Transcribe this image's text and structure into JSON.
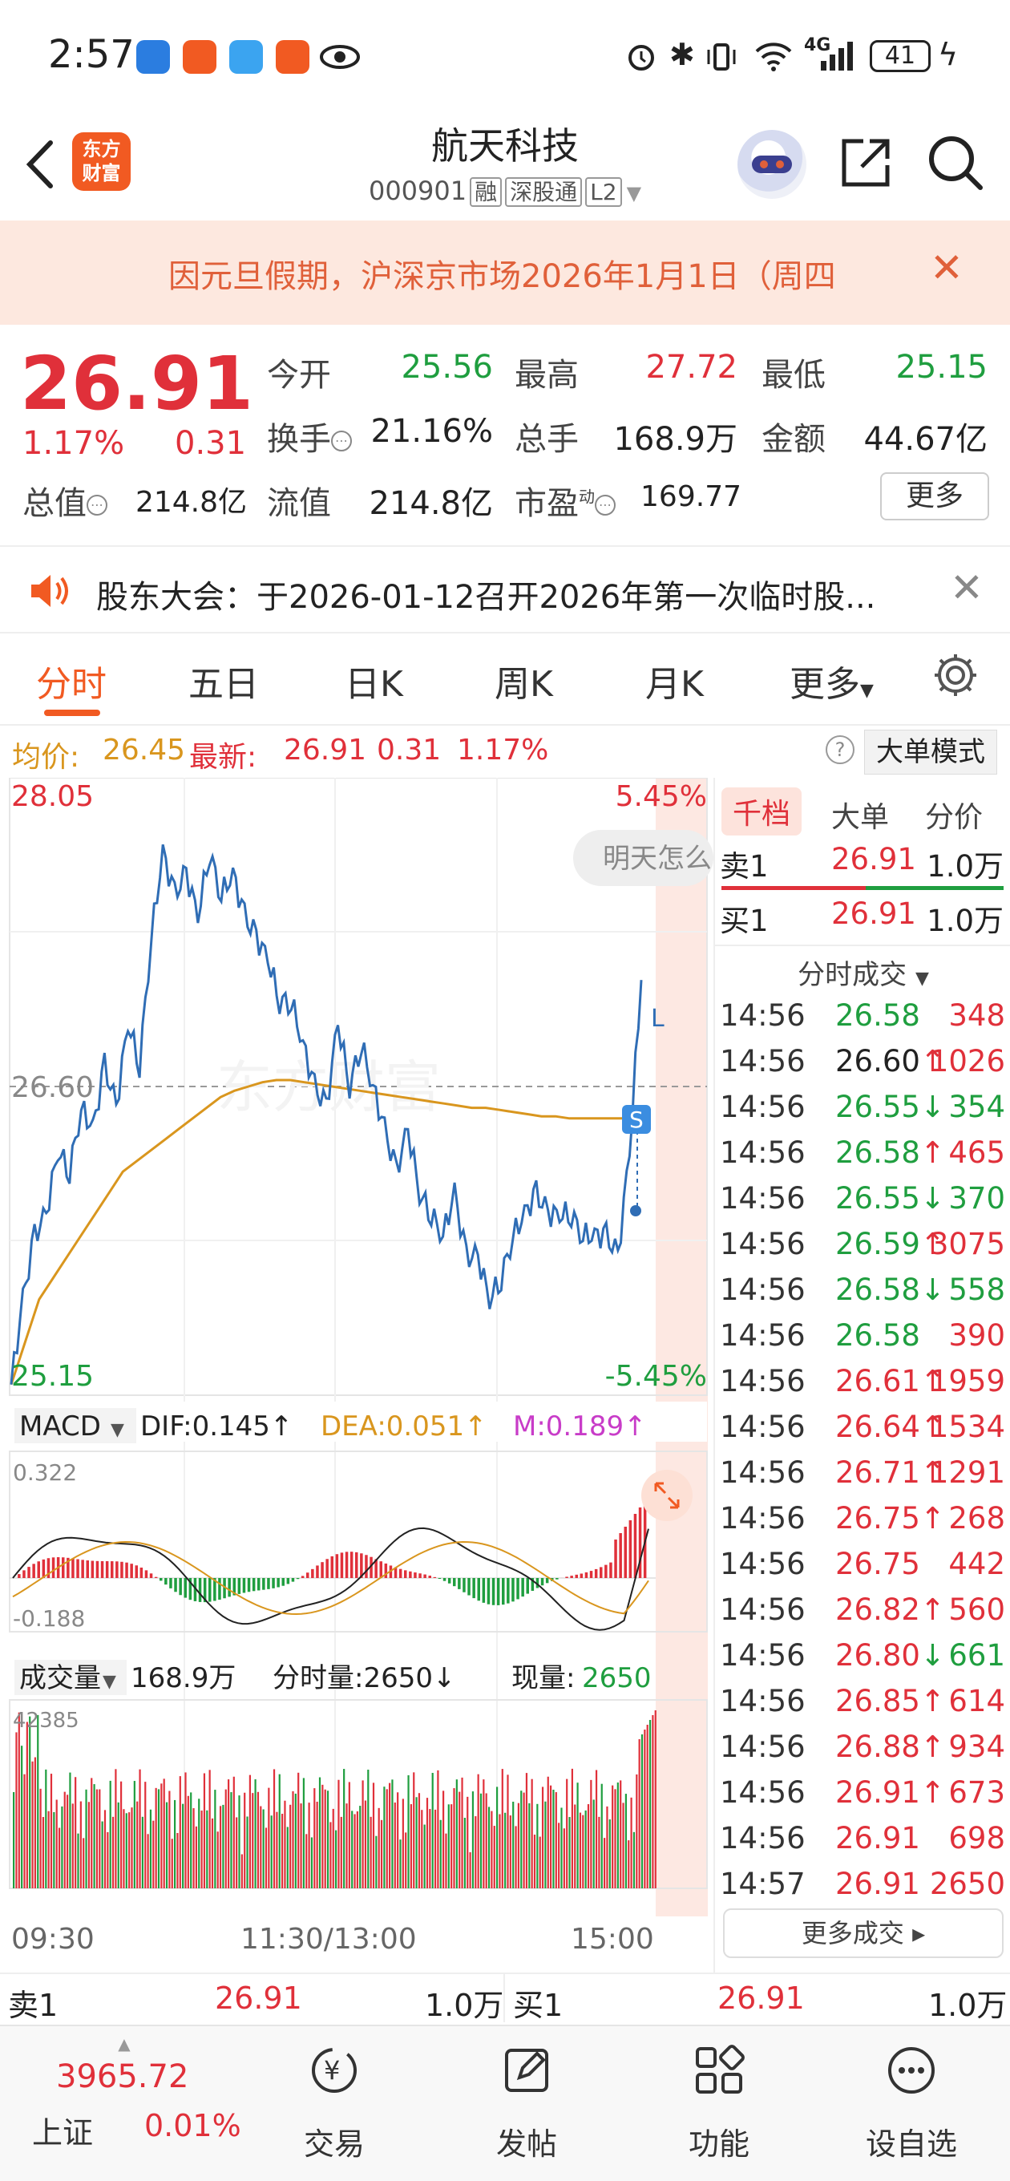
{
  "status_bar": {
    "time": "2:57",
    "network": "4G",
    "battery": "41"
  },
  "header": {
    "logo_text_1": "东方",
    "logo_text_2": "财富",
    "title": "航天科技",
    "code": "000901",
    "tags": [
      "融",
      "深股通",
      "L2"
    ]
  },
  "notice": {
    "text": "因元旦假期，沪深京市场2026年1月1日（周四"
  },
  "quote": {
    "price": "26.91",
    "change_pct": "1.17%",
    "change": "0.31",
    "open_label": "今开",
    "open": "25.56",
    "high_label": "最高",
    "high": "27.72",
    "low_label": "最低",
    "low": "25.15",
    "turnover_label": "换手",
    "turnover": "21.16%",
    "volume_label": "总手",
    "volume": "168.9万",
    "amount_label": "金额",
    "amount": "44.67亿",
    "mktcap_label": "总值",
    "mktcap": "214.8亿",
    "float_label": "流值",
    "float": "214.8亿",
    "pe_label": "市盈",
    "pe_sup": "动",
    "pe": "169.77",
    "more": "更多"
  },
  "announcement": {
    "text": "股东大会：于2026-01-12召开2026年第一次临时股..."
  },
  "tabs": [
    "分时",
    "五日",
    "日K",
    "周K",
    "月K",
    "更多"
  ],
  "summary": {
    "avg_label": "均价:",
    "avg": "26.45",
    "latest_label": "最新:",
    "latest": "26.91",
    "chg": "0.31",
    "pct": "1.17%",
    "big_order_mode": "大单模式"
  },
  "chart_labels": {
    "y_top": "28.05",
    "y_top_pct": "5.45%",
    "y_mid": "26.60",
    "y_bottom": "25.15",
    "y_bottom_pct": "-5.45%",
    "tooltip": "明天怎么",
    "s_badge": "S",
    "macd_title": "MACD",
    "dif": "DIF:0.145↑",
    "dea": "DEA:0.051↑",
    "m": "M:0.189↑",
    "macd_top": "0.322",
    "macd_bottom": "-0.188",
    "vol_title": "成交量",
    "vol_total": "168.9万",
    "tick_vol": "分时量:2650↓",
    "cur_vol_label": "现量:",
    "cur_vol": "2650",
    "vol_max": "42385",
    "x_start": "09:30",
    "x_mid": "11:30/13:00",
    "x_end": "15:00"
  },
  "chart_data": {
    "type": "line",
    "price_ylim": [
      25.15,
      28.05
    ],
    "prev_close": 26.6,
    "series": [
      {
        "name": "最新",
        "values": [
          25.2,
          25.6,
          25.9,
          26.0,
          26.3,
          26.2,
          26.5,
          26.4,
          26.7,
          26.5,
          26.9,
          26.7,
          27.3,
          27.7,
          27.5,
          27.6,
          27.4,
          27.7,
          27.5,
          27.6,
          27.4,
          27.3,
          27.2,
          27.0,
          27.0,
          26.8,
          26.6,
          26.5,
          26.9,
          26.6,
          26.8,
          26.6,
          26.4,
          26.2,
          26.4,
          26.1,
          26.0,
          25.9,
          26.1,
          25.8,
          25.8,
          25.6,
          25.7,
          25.9,
          26.0,
          26.1,
          26.0,
          26.0,
          26.0,
          25.9,
          25.9,
          25.9,
          25.8,
          26.3,
          27.1
        ]
      },
      {
        "name": "均价",
        "values": [
          25.2,
          25.4,
          25.6,
          25.7,
          25.8,
          25.9,
          26.0,
          26.1,
          26.2,
          26.25,
          26.3,
          26.35,
          26.4,
          26.45,
          26.5,
          26.55,
          26.58,
          26.6,
          26.62,
          26.63,
          26.63,
          26.62,
          26.61,
          26.6,
          26.59,
          26.58,
          26.57,
          26.56,
          26.55,
          26.54,
          26.53,
          26.52,
          26.51,
          26.5,
          26.5,
          26.49,
          26.48,
          26.47,
          26.46,
          26.46,
          26.45,
          26.45,
          26.45,
          26.45,
          26.45
        ]
      }
    ],
    "macd": {
      "ylim": [
        -0.188,
        0.322
      ],
      "dif": 0.145,
      "dea": 0.051,
      "m": 0.189
    },
    "volume": {
      "max": 42385,
      "total": "168.9万"
    }
  },
  "right_panel": {
    "tabs": [
      "千档",
      "大单",
      "分价"
    ],
    "orderbook": [
      {
        "label": "卖1",
        "price": "26.91",
        "vol": "1.0万"
      },
      {
        "label": "买1",
        "price": "26.91",
        "vol": "1.0万"
      }
    ],
    "trades_title": "分时成交",
    "trades": [
      {
        "time": "14:56",
        "price": "26.58",
        "pc": "green",
        "arrow": "",
        "vol": "348",
        "vc": "red"
      },
      {
        "time": "14:56",
        "price": "26.60",
        "pc": "black",
        "arrow": "↑",
        "vol": "1026",
        "vc": "red"
      },
      {
        "time": "14:56",
        "price": "26.55",
        "pc": "green",
        "arrow": "↓",
        "vol": "354",
        "vc": "green"
      },
      {
        "time": "14:56",
        "price": "26.58",
        "pc": "green",
        "arrow": "↑",
        "vol": "465",
        "vc": "red"
      },
      {
        "time": "14:56",
        "price": "26.55",
        "pc": "green",
        "arrow": "↓",
        "vol": "370",
        "vc": "green"
      },
      {
        "time": "14:56",
        "price": "26.59",
        "pc": "green",
        "arrow": "↑",
        "vol": "3075",
        "vc": "red"
      },
      {
        "time": "14:56",
        "price": "26.58",
        "pc": "green",
        "arrow": "↓",
        "vol": "558",
        "vc": "green"
      },
      {
        "time": "14:56",
        "price": "26.58",
        "pc": "green",
        "arrow": "",
        "vol": "390",
        "vc": "red"
      },
      {
        "time": "14:56",
        "price": "26.61",
        "pc": "red",
        "arrow": "↑",
        "vol": "1959",
        "vc": "red"
      },
      {
        "time": "14:56",
        "price": "26.64",
        "pc": "red",
        "arrow": "↑",
        "vol": "1534",
        "vc": "red"
      },
      {
        "time": "14:56",
        "price": "26.71",
        "pc": "red",
        "arrow": "↑",
        "vol": "1291",
        "vc": "red"
      },
      {
        "time": "14:56",
        "price": "26.75",
        "pc": "red",
        "arrow": "↑",
        "vol": "268",
        "vc": "red"
      },
      {
        "time": "14:56",
        "price": "26.75",
        "pc": "red",
        "arrow": "",
        "vol": "442",
        "vc": "red"
      },
      {
        "time": "14:56",
        "price": "26.82",
        "pc": "red",
        "arrow": "↑",
        "vol": "560",
        "vc": "red"
      },
      {
        "time": "14:56",
        "price": "26.80",
        "pc": "red",
        "arrow": "↓",
        "vol": "661",
        "vc": "green"
      },
      {
        "time": "14:56",
        "price": "26.85",
        "pc": "red",
        "arrow": "↑",
        "vol": "614",
        "vc": "red"
      },
      {
        "time": "14:56",
        "price": "26.88",
        "pc": "red",
        "arrow": "↑",
        "vol": "934",
        "vc": "red"
      },
      {
        "time": "14:56",
        "price": "26.91",
        "pc": "red",
        "arrow": "↑",
        "vol": "673",
        "vc": "red"
      },
      {
        "time": "14:56",
        "price": "26.91",
        "pc": "red",
        "arrow": "",
        "vol": "698",
        "vc": "red"
      },
      {
        "time": "14:57",
        "price": "26.91",
        "pc": "red",
        "arrow": "",
        "vol": "2650",
        "vc": "red"
      }
    ],
    "more_trades": "更多成交"
  },
  "bottom_quote": {
    "sell_label": "卖1",
    "sell_price": "26.91",
    "sell_vol": "1.0万",
    "buy_label": "买1",
    "buy_price": "26.91",
    "buy_vol": "1.0万"
  },
  "nav": {
    "index_value": "3965.72",
    "index_name": "上证",
    "index_pct": "0.01%",
    "items": [
      "交易",
      "发帖",
      "功能",
      "设自选"
    ]
  },
  "colors": {
    "red": "#e0303a",
    "green": "#1f9e3f",
    "orange": "#f15a22",
    "avg_line": "#d9961e",
    "price_line": "#2f6db5"
  }
}
